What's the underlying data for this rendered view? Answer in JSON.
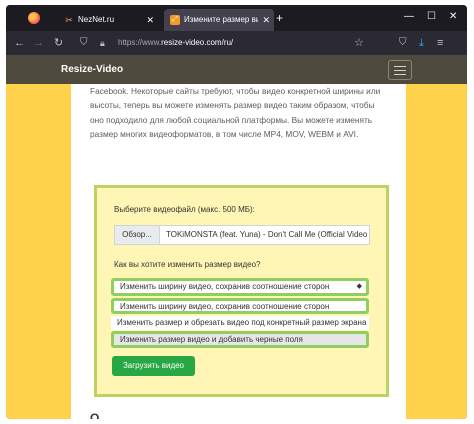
{
  "browser": {
    "tabs": [
      {
        "title": "NezNet.ru",
        "icon": "scissors-icon",
        "active": false
      },
      {
        "title": "Измените размер видео онлайн",
        "icon": "resize-icon",
        "active": true
      }
    ],
    "new_tab": "+",
    "controls": {
      "minimize": "—",
      "maximize": "☐",
      "close": "✕"
    },
    "url_prefix": "https://www.",
    "url_host": "resize-video.com/ru/"
  },
  "site": {
    "brand": "Resize-Video",
    "paragraph": "и в соответствии с требованиями к размерам видео в Instagram, Twitter или Facebook. Некоторые сайты требуют, чтобы видео конкретной ширины или высоты, теперь вы можете изменять размер видео таким образом, чтобы оно подходило для любой социальной платформы. Вы можете изменять размер многих видеоформатов, в том числе MP4, MOV, WEBM и AVI."
  },
  "form": {
    "file_label": "Выберите видеофайл (макс. 500 МБ):",
    "browse_button": "Обзор...",
    "file_name": "TOKiMONSTA (feat. Yuna) - Don't Call Me (Official Video",
    "resize_question": "Как вы хотите изменить размер видео?",
    "selected_option": "Изменить ширину видео, сохранив соотношение сторон",
    "options": [
      "Изменить ширину видео, сохранив соотношение сторон",
      "Изменить размер и обрезать видео под конкретный размер экрана",
      "Изменить размер видео и добавить черные поля"
    ],
    "upload_button": "Загрузить видео"
  },
  "colors": {
    "page_bg": "#ffd24c",
    "form_border": "#bcd263",
    "form_bg": "#fff6b5",
    "highlight": "#8fce5f",
    "upload_bg": "#28a745",
    "topbar": "#4e4a3d"
  }
}
